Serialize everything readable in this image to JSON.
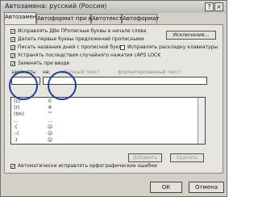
{
  "window": {
    "title": "Автозамена: русский (Россия)",
    "help": "?",
    "close": "×"
  },
  "tabs": [
    "Автозамена",
    "Автоформат при вводе",
    "Автотекст",
    "Автоформат"
  ],
  "options": [
    {
      "label": "Исправлять ДВе ПРописные буквы в начале слова",
      "checked": "✓"
    },
    {
      "label": "Делать первые буквы предложений прописными",
      "checked": "✓"
    },
    {
      "label": "Писать названия дней с прописной буквы",
      "checked": "✓"
    },
    {
      "label": "Устранять последствия случайного нажатия cAPS LOCK",
      "checked": "✓"
    },
    {
      "label": "Заменять при вводе",
      "checked": "✓"
    }
  ],
  "exceptions_button": "Исключения...",
  "keyboard_option": {
    "label": "Исправлять раскладку клавиатуры",
    "checked": ""
  },
  "replace_label": "заменять:",
  "with_label": "на:",
  "plain_text": "обычный текст",
  "formatted_text": "форматированный текст",
  "list_rows": [
    {
      "a": "(c)",
      "b": "©"
    },
    {
      "a": "(r)",
      "b": "®"
    },
    {
      "a": "(tm)",
      "b": "™"
    },
    {
      "a": "...",
      "b": "…"
    },
    {
      "a": ":(",
      "b": "☹"
    },
    {
      "a": ":-(",
      "b": "☹"
    },
    {
      "a": ":)",
      "b": "☺"
    }
  ],
  "add_button": "Добавить",
  "delete_button": "Удалить",
  "bottom_option": {
    "label": "Автоматически исправлять орфографические ошибки",
    "checked": "✓"
  },
  "ok_button": "ОК",
  "cancel_button": "Отмена"
}
